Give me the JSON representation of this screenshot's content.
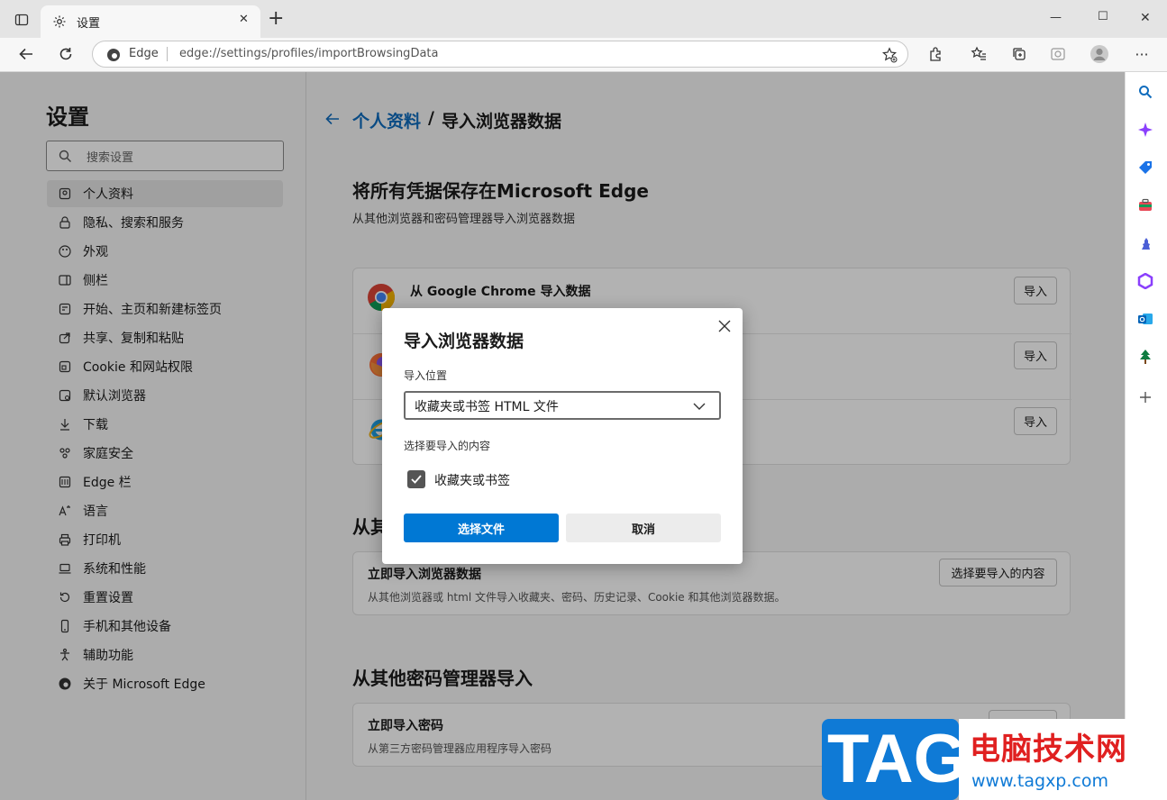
{
  "window": {
    "tab_title": "设置",
    "new_tab_glyph": "+",
    "min_glyph": "—",
    "max_glyph": "☐",
    "close_glyph": "✕"
  },
  "address": {
    "site_label": "Edge",
    "url": "edge://settings/profiles/importBrowsingData"
  },
  "settings": {
    "title": "设置",
    "search_placeholder": "搜索设置",
    "nav": [
      {
        "label": "个人资料",
        "icon": "profile-icon"
      },
      {
        "label": "隐私、搜索和服务",
        "icon": "lock-icon"
      },
      {
        "label": "外观",
        "icon": "palette-icon"
      },
      {
        "label": "侧栏",
        "icon": "sidebar-icon"
      },
      {
        "label": "开始、主页和新建标签页",
        "icon": "home-icon"
      },
      {
        "label": "共享、复制和粘贴",
        "icon": "share-icon"
      },
      {
        "label": "Cookie 和网站权限",
        "icon": "cookie-icon"
      },
      {
        "label": "默认浏览器",
        "icon": "browser-icon"
      },
      {
        "label": "下载",
        "icon": "download-icon"
      },
      {
        "label": "家庭安全",
        "icon": "family-icon"
      },
      {
        "label": "Edge 栏",
        "icon": "edge-bar-icon"
      },
      {
        "label": "语言",
        "icon": "language-icon"
      },
      {
        "label": "打印机",
        "icon": "printer-icon"
      },
      {
        "label": "系统和性能",
        "icon": "laptop-icon"
      },
      {
        "label": "重置设置",
        "icon": "reset-icon"
      },
      {
        "label": "手机和其他设备",
        "icon": "phone-icon"
      },
      {
        "label": "辅助功能",
        "icon": "accessibility-icon"
      },
      {
        "label": "关于 Microsoft Edge",
        "icon": "edge-logo-icon"
      }
    ]
  },
  "main": {
    "breadcrumb_parent": "个人资料",
    "breadcrumb_separator": "/",
    "breadcrumb_current": "导入浏览器数据",
    "section1_title": "将所有凭据保存在Microsoft Edge",
    "section1_desc": "从其他浏览器和密码管理器导入浏览器数据",
    "sources": [
      {
        "name": "从 Google Chrome 导入数据",
        "button": "导入",
        "icon": "chrome-icon"
      },
      {
        "name": "",
        "button": "导入",
        "icon": "firefox-icon"
      },
      {
        "name": "",
        "button": "导入",
        "icon": "ie-icon"
      }
    ],
    "section2_title_partial": "从其",
    "import_now_title": "立即导入浏览器数据",
    "import_now_desc": "从其他浏览器或 html 文件导入收藏夹、密码、历史记录、Cookie 和其他浏览器数据。",
    "import_now_button": "选择要导入的内容",
    "section3_title": "从其他密码管理器导入",
    "pw_title": "立即导入密码",
    "pw_desc": "从第三方密码管理器应用程序导入密码"
  },
  "dialog": {
    "title": "导入浏览器数据",
    "location_label": "导入位置",
    "location_value": "收藏夹或书签 HTML 文件",
    "content_label": "选择要导入的内容",
    "checkbox_label": "收藏夹或书签",
    "checkbox_checked": true,
    "primary_button": "选择文件",
    "secondary_button": "取消"
  },
  "watermark": {
    "logo_text": "TAG",
    "site_name": "电脑技术网",
    "site_url": "www.tagxp.com"
  },
  "colors": {
    "accent": "#0f6cbd",
    "primary_button": "#0078d4",
    "dialog_title": "#1b1b1b"
  }
}
